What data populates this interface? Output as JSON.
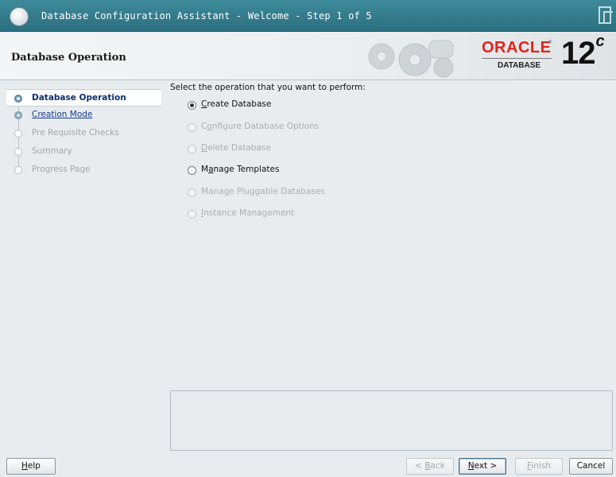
{
  "window": {
    "title": "Database Configuration Assistant - Welcome - Step 1 of 5"
  },
  "header": {
    "title": "Database Operation",
    "brand": {
      "oracle": "ORACLE",
      "reg": "®",
      "product": "DATABASE",
      "version": "12",
      "version_suffix": "c",
      "accent_color": "#e2231a"
    }
  },
  "nav": {
    "items": [
      {
        "label": "Database Operation",
        "state": "active"
      },
      {
        "label": "Creation Mode",
        "state": "link"
      },
      {
        "label": "Pre Requisite Checks",
        "state": "disabled"
      },
      {
        "label": "Summary",
        "state": "disabled"
      },
      {
        "label": "Progress Page",
        "state": "disabled"
      }
    ]
  },
  "main": {
    "prompt": "Select the operation that you want to perform:",
    "options": [
      {
        "mnemonic": "C",
        "rest": "reate Database",
        "selected": true,
        "enabled": true
      },
      {
        "pre": "C",
        "mnemonic": "o",
        "rest": "nfigure Database Options",
        "selected": false,
        "enabled": false
      },
      {
        "mnemonic": "D",
        "rest": "elete Database",
        "selected": false,
        "enabled": false
      },
      {
        "pre": "M",
        "mnemonic": "a",
        "rest": "nage Templates",
        "selected": false,
        "enabled": true
      },
      {
        "pre": "Mana",
        "mnemonic": "g",
        "rest": "e Pluggable Databases",
        "selected": false,
        "enabled": false
      },
      {
        "mnemonic": "I",
        "rest": "nstance Management",
        "selected": false,
        "enabled": false
      }
    ]
  },
  "footer": {
    "help": {
      "mnemonic": "H",
      "rest": "elp"
    },
    "back": {
      "pre": "< ",
      "mnemonic": "B",
      "rest": "ack"
    },
    "next": {
      "mnemonic": "N",
      "rest": "ext >"
    },
    "finish": {
      "mnemonic": "F",
      "rest": "inish"
    },
    "cancel": "Cancel"
  }
}
